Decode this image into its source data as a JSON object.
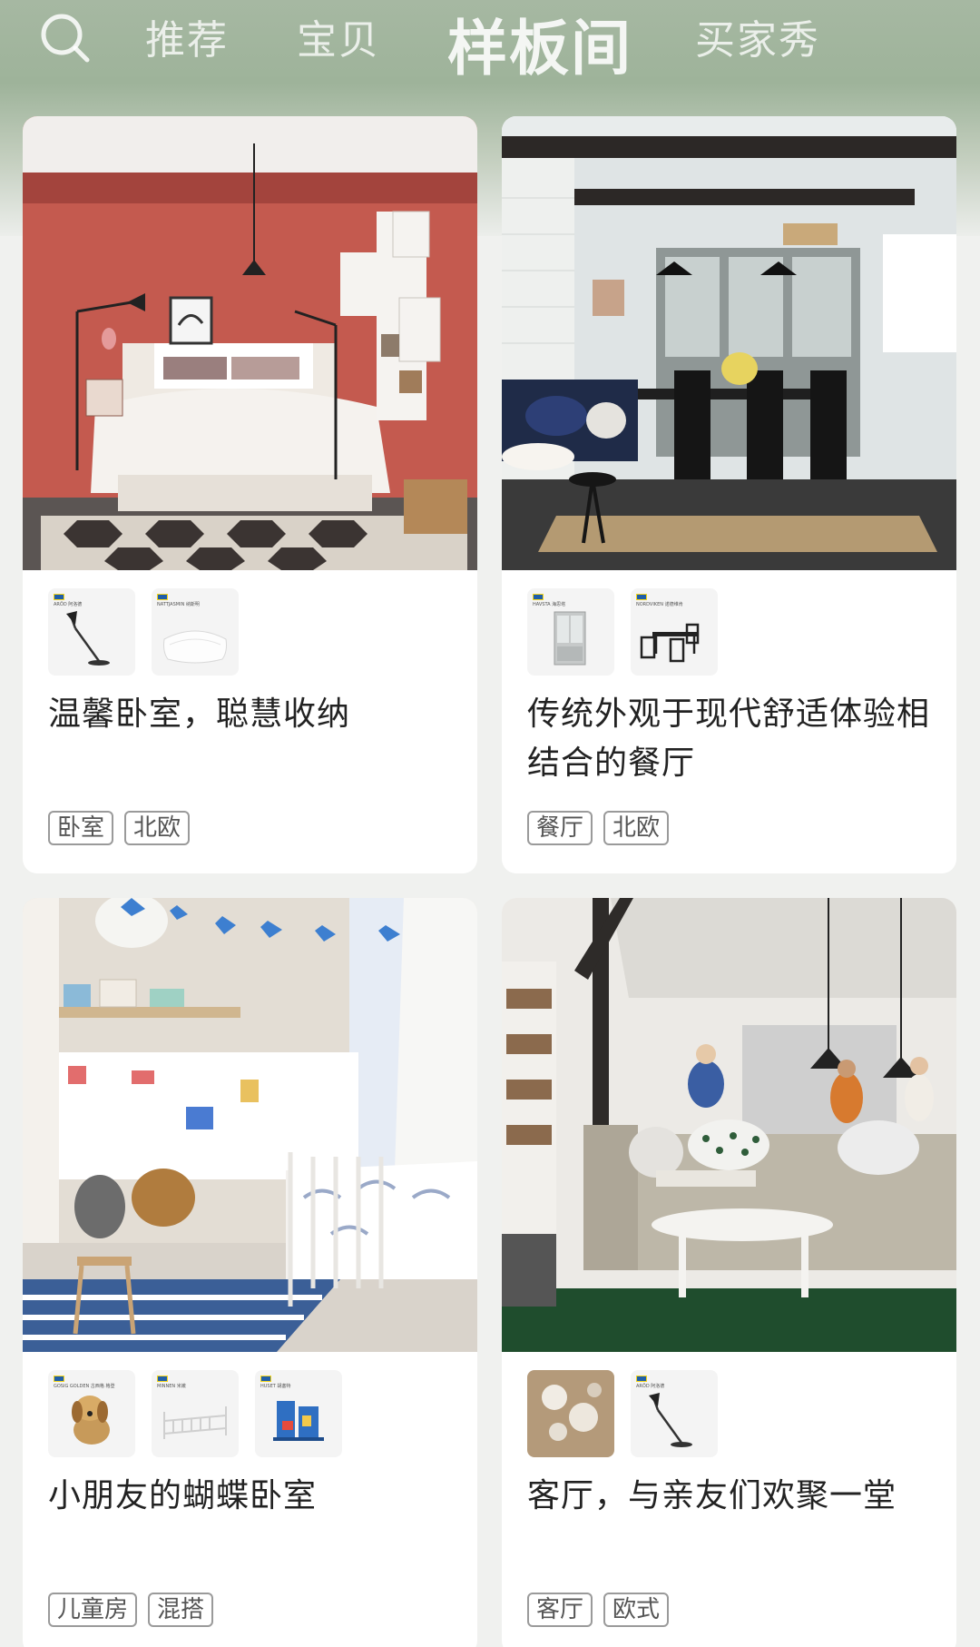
{
  "nav": {
    "tabs": [
      {
        "label": "推荐",
        "active": false
      },
      {
        "label": "宝贝",
        "active": false
      },
      {
        "label": "样板间",
        "active": true
      },
      {
        "label": "买家秀",
        "active": false
      }
    ]
  },
  "cards": [
    {
      "title": "温馨卧室，聪慧收纳",
      "tags": [
        "卧室",
        "北欧"
      ],
      "thumbs": [
        {
          "name": "ARÖD 阿洛德",
          "icon": "desk-lamp"
        },
        {
          "name": "NATTJASMIN 纳斯明",
          "icon": "pillow"
        }
      ]
    },
    {
      "title": "传统外观于现代舒适体验相结合的餐厅",
      "tags": [
        "餐厅",
        "北欧"
      ],
      "thumbs": [
        {
          "name": "HAVSTA 海思塔",
          "icon": "cabinet"
        },
        {
          "name": "NORDVIKEN 诺德维肯",
          "icon": "dining-set"
        }
      ]
    },
    {
      "title": "小朋友的蝴蝶卧室",
      "tags": [
        "儿童房",
        "混搭"
      ],
      "thumbs": [
        {
          "name": "GOSIG GOLDEN 古西格 格登",
          "icon": "plush-dog"
        },
        {
          "name": "MINNEN 米嫩",
          "icon": "kids-bed"
        },
        {
          "name": "HUSET 胡塞特",
          "icon": "doll-house"
        }
      ]
    },
    {
      "title": "客厅，与亲友们欢聚一堂",
      "tags": [
        "客厅",
        "欧式"
      ],
      "thumbs": [
        {
          "name": "",
          "icon": "tableware-photo"
        },
        {
          "name": "ARÖD 阿洛德",
          "icon": "desk-lamp"
        }
      ]
    }
  ]
}
